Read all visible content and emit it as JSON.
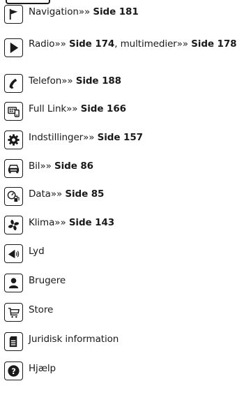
{
  "menu": {
    "items": [
      {
        "icon": "flag-icon",
        "label": "Navigation",
        "arrow": "»»",
        "page_ref": "Side 181"
      },
      {
        "icon": "play-icon",
        "label": "Radio",
        "arrow": "»»",
        "page_ref": "Side 174",
        "separator": ", multimedier",
        "arrow2": "»»",
        "page_ref2": "Side 178"
      },
      {
        "icon": "phone-icon",
        "label": "Telefon",
        "arrow": "»»",
        "page_ref": "Side 188"
      },
      {
        "icon": "full-link-icon",
        "label": "Full Link",
        "arrow": "»»",
        "page_ref": "Side 166"
      },
      {
        "icon": "gear-icon",
        "label": "Indstillinger",
        "arrow": "»»",
        "page_ref": "Side 157"
      },
      {
        "icon": "car-icon",
        "label": "Bil",
        "arrow": "»»",
        "page_ref": "Side 86"
      },
      {
        "icon": "fuel-data-icon",
        "label": "Data",
        "arrow": "»»",
        "page_ref": "Side 85"
      },
      {
        "icon": "fan-icon",
        "label": "Klima",
        "arrow": "»»",
        "page_ref": "Side 143"
      },
      {
        "icon": "speaker-icon",
        "label": "Lyd"
      },
      {
        "icon": "user-icon",
        "label": "Brugere"
      },
      {
        "icon": "cart-icon",
        "label": "Store"
      },
      {
        "icon": "document-icon",
        "label": "Juridisk information"
      },
      {
        "icon": "help-icon",
        "label": "Hjælp"
      }
    ]
  }
}
